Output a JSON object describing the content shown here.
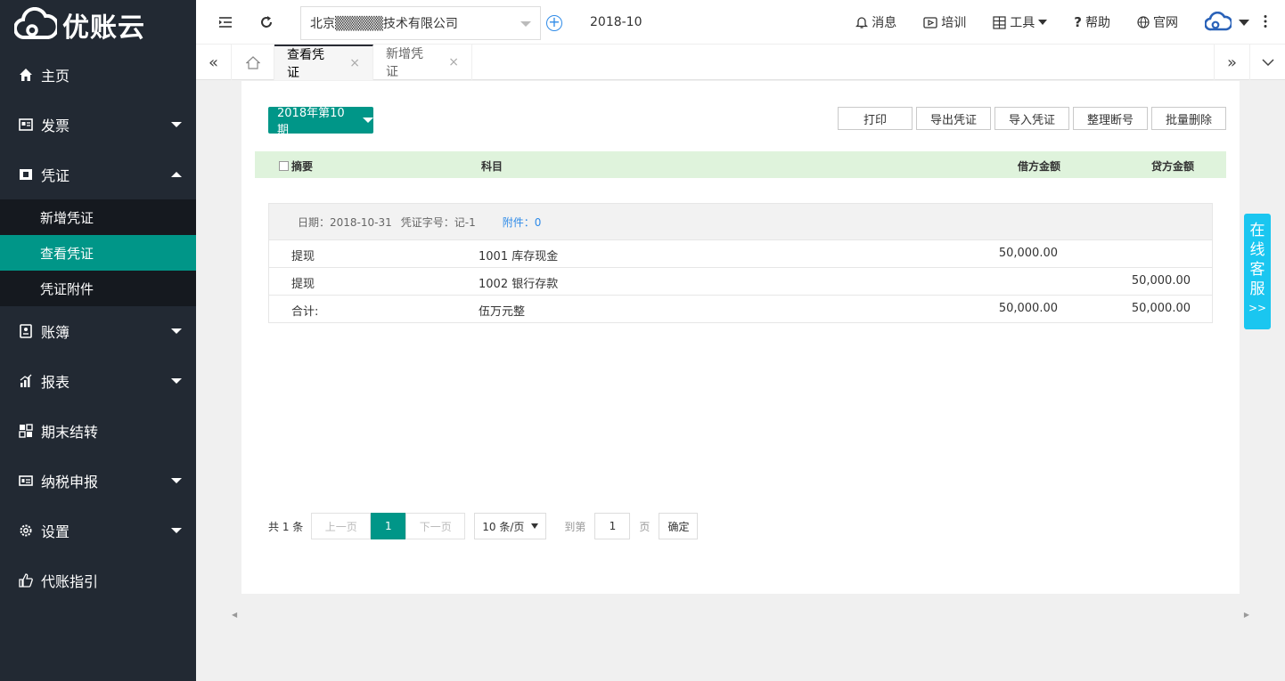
{
  "app": {
    "logo_text": "优账云"
  },
  "sidebar": {
    "items": [
      {
        "label": "主页",
        "icon": "home-icon"
      },
      {
        "label": "发票",
        "icon": "invoice-icon"
      },
      {
        "label": "凭证",
        "icon": "voucher-icon"
      },
      {
        "label": "账簿",
        "icon": "ledger-icon"
      },
      {
        "label": "报表",
        "icon": "report-icon"
      },
      {
        "label": "期末结转",
        "icon": "carryover-icon"
      },
      {
        "label": "纳税申报",
        "icon": "tax-icon"
      },
      {
        "label": "设置",
        "icon": "gear-icon"
      },
      {
        "label": "代账指引",
        "icon": "thumb-icon"
      }
    ],
    "voucher_sub": [
      "新增凭证",
      "查看凭证",
      "凭证附件"
    ]
  },
  "header": {
    "company": "北京▒▒▒▒▒技术有限公司",
    "period": "2018-10",
    "links": {
      "message": "消息",
      "training": "培训",
      "tools": "工具",
      "help": "帮助",
      "website": "官网"
    }
  },
  "tabs": [
    {
      "label": "查看凭证"
    },
    {
      "label": "新增凭证"
    }
  ],
  "toolbar": {
    "period_label": "2018年第10期",
    "print": "打印",
    "export": "导出凭证",
    "import": "导入凭证",
    "renumber": "整理断号",
    "batch_delete": "批量删除"
  },
  "table": {
    "headers": {
      "summary": "摘要",
      "subject": "科目",
      "debit": "借方金额",
      "credit": "贷方金额"
    }
  },
  "voucher": {
    "date": "日期：2018-10-31",
    "number": "凭证字号：记-1",
    "attachment": "附件：0",
    "rows": [
      {
        "summary": "提现",
        "subject": "1001 库存现金",
        "debit": "50,000.00",
        "credit": ""
      },
      {
        "summary": "提现",
        "subject": "1002 银行存款",
        "debit": "",
        "credit": "50,000.00"
      },
      {
        "summary": "合计:",
        "subject": "伍万元整",
        "debit": "50,000.00",
        "credit": "50,000.00"
      }
    ]
  },
  "pager": {
    "total": "共 1 条",
    "prev": "上一页",
    "current": "1",
    "next": "下一页",
    "page_size": "10 条/页",
    "goto_prefix": "到第",
    "goto_value": "1",
    "goto_suffix": "页",
    "confirm": "确定"
  },
  "service": {
    "chars": [
      "在",
      "线",
      "客",
      "服"
    ],
    "arrow": ">>"
  },
  "colors": {
    "primary": "#009688",
    "sidebar": "#222933",
    "header_green": "#dff3dc",
    "service": "#1ac6f0",
    "link": "#2f8be8"
  }
}
